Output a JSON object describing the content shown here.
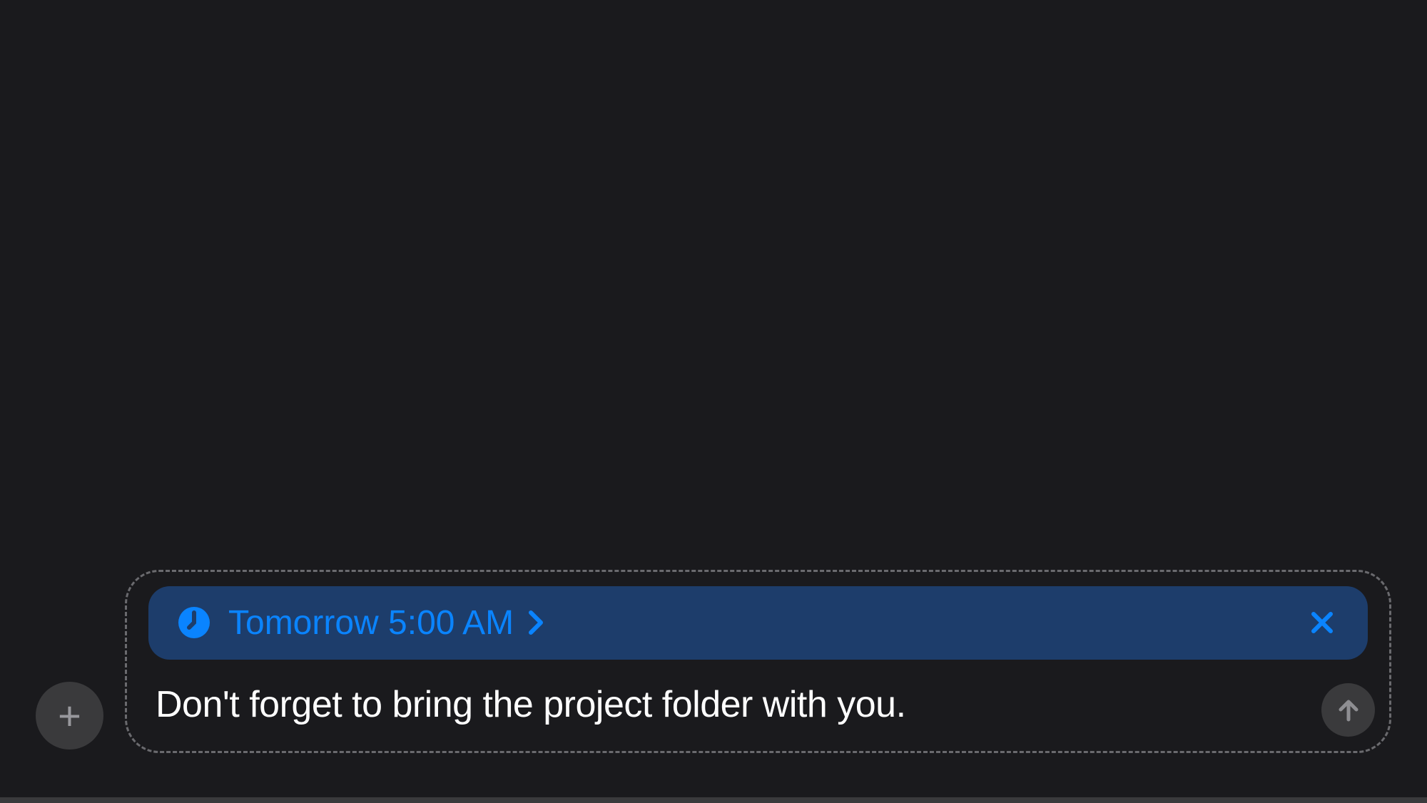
{
  "compose": {
    "schedule": {
      "label": "Tomorrow 5:00 AM"
    },
    "message": "Don't forget to bring the project folder with you."
  },
  "icons": {
    "plus": "plus-icon",
    "clock": "clock-icon",
    "chevron_right": "chevron-right-icon",
    "close": "close-icon",
    "arrow_up": "arrow-up-icon"
  },
  "colors": {
    "background": "#1a1a1d",
    "banner": "#1d3d6b",
    "accent": "#0a84ff",
    "text": "#ffffff",
    "muted": "#98989d",
    "button": "#3a3a3c"
  }
}
